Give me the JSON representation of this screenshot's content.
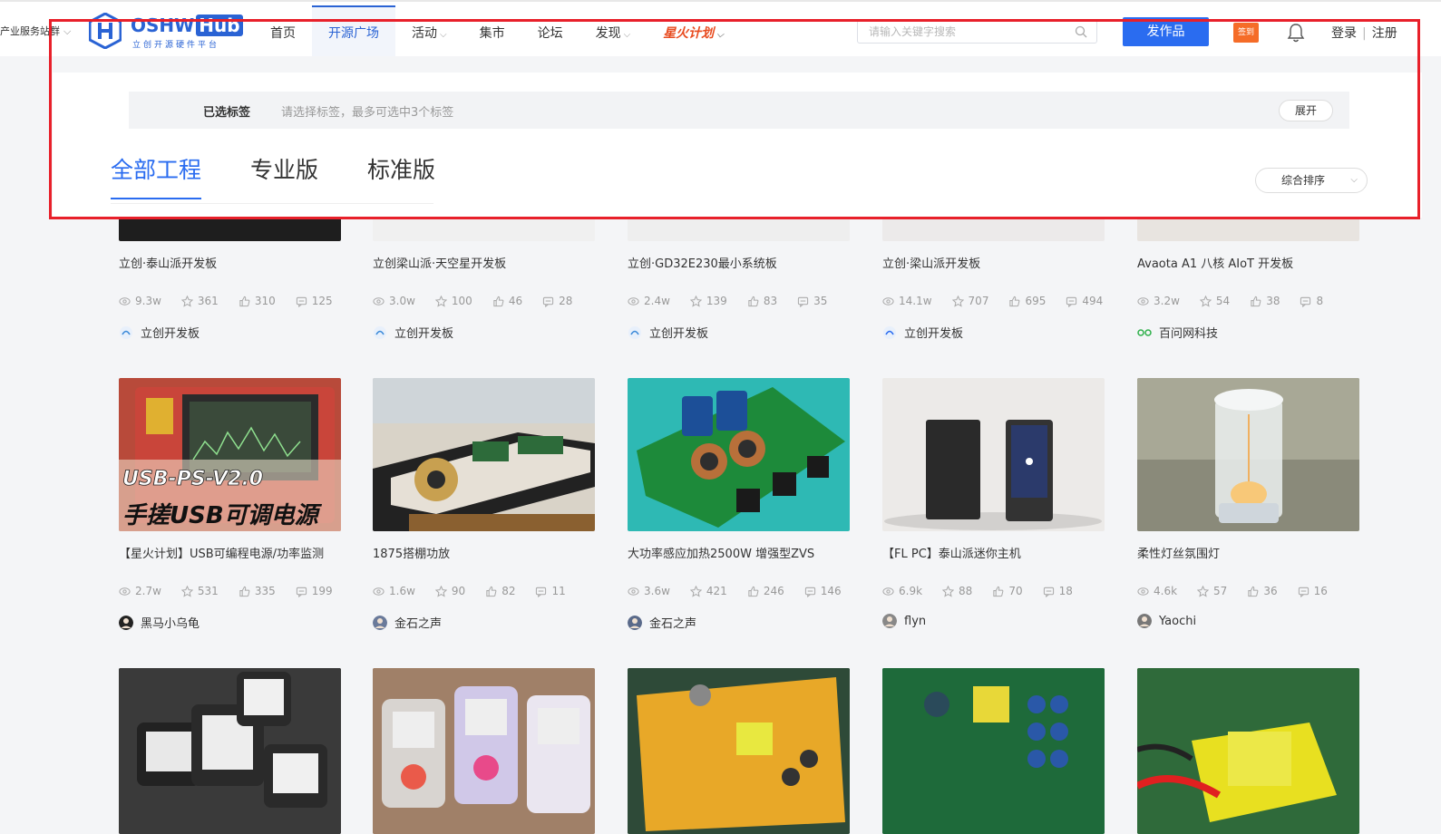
{
  "header": {
    "left_link": "产业服务站群",
    "logo_word": "OSHW",
    "logo_hub": "Hub",
    "logo_sub": "立创开源硬件平台",
    "nav": [
      {
        "label": "首页",
        "chev": false,
        "active": false,
        "fire": false
      },
      {
        "label": "开源广场",
        "chev": false,
        "active": true,
        "fire": false
      },
      {
        "label": "活动",
        "chev": true,
        "active": false,
        "fire": false
      },
      {
        "label": "集市",
        "chev": false,
        "active": false,
        "fire": false
      },
      {
        "label": "论坛",
        "chev": false,
        "active": false,
        "fire": false
      },
      {
        "label": "发现",
        "chev": true,
        "active": false,
        "fire": false
      },
      {
        "label": "星火计划",
        "chev": true,
        "active": false,
        "fire": true
      }
    ],
    "search_placeholder": "请输入关键字搜索",
    "publish_label": "发作品",
    "checkin_label": "签到",
    "login": "登录",
    "register": "注册"
  },
  "filter": {
    "selected_label": "已选标签",
    "hint": "请选择标签，最多可选中3个标签",
    "expand": "展开"
  },
  "tabs": [
    "全部工程",
    "专业版",
    "标准版"
  ],
  "sort_label": "综合排序",
  "colors": {
    "accent": "#2a6cf0",
    "highlight": "#e8202a",
    "fire": "#e84b1f"
  },
  "row1": [
    {
      "title": "立创·泰山派开发板",
      "views": "9.3w",
      "stars": "361",
      "likes": "310",
      "comments": "125",
      "author": "立创开发板"
    },
    {
      "title": "立创梁山派·天空星开发板",
      "views": "3.0w",
      "stars": "100",
      "likes": "46",
      "comments": "28",
      "author": "立创开发板"
    },
    {
      "title": "立创·GD32E230最小系统板",
      "views": "2.4w",
      "stars": "139",
      "likes": "83",
      "comments": "35",
      "author": "立创开发板"
    },
    {
      "title": "立创·梁山派开发板",
      "views": "14.1w",
      "stars": "707",
      "likes": "695",
      "comments": "494",
      "author": "立创开发板"
    },
    {
      "title": "Avaota A1 八核 AIoT 开发板",
      "views": "3.2w",
      "stars": "54",
      "likes": "38",
      "comments": "8",
      "author": "百问网科技"
    }
  ],
  "row2": [
    {
      "title": "【星火计划】USB可编程电源/功率监测",
      "views": "2.7w",
      "stars": "531",
      "likes": "335",
      "comments": "199",
      "author": "黑马小乌龟",
      "thumb_text_1": "USB-PS-V2.0",
      "thumb_text_2": "手搓USB可调电源"
    },
    {
      "title": "1875搭棚功放",
      "views": "1.6w",
      "stars": "90",
      "likes": "82",
      "comments": "11",
      "author": "金石之声"
    },
    {
      "title": "大功率感应加热2500W 增强型ZVS",
      "views": "3.6w",
      "stars": "421",
      "likes": "246",
      "comments": "146",
      "author": "金石之声"
    },
    {
      "title": "【FL PC】泰山派迷你主机",
      "views": "6.9k",
      "stars": "88",
      "likes": "70",
      "comments": "18",
      "author": "flyn"
    },
    {
      "title": "柔性灯丝氛围灯",
      "views": "4.6k",
      "stars": "57",
      "likes": "36",
      "comments": "16",
      "author": "Yaochi"
    }
  ]
}
